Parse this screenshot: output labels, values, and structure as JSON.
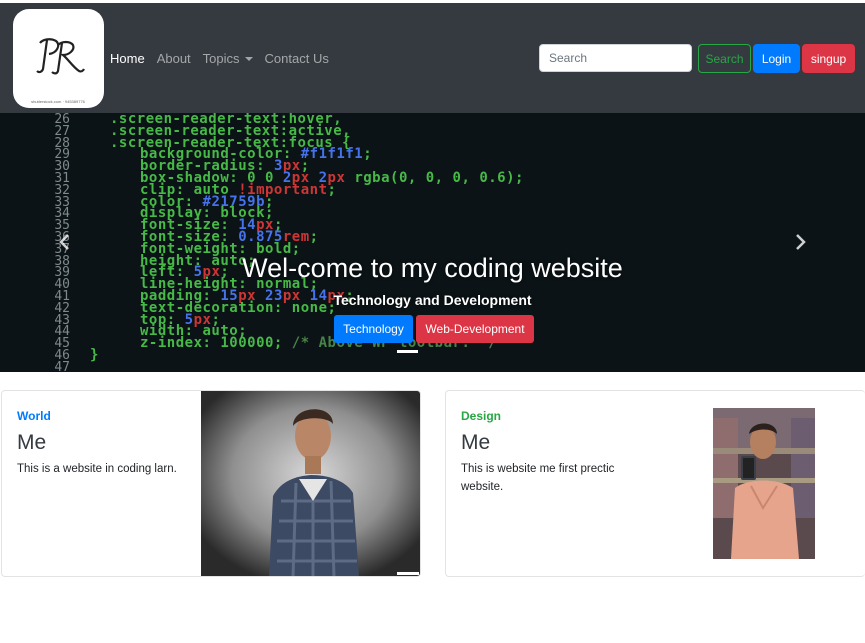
{
  "navbar": {
    "logo_text": "PR",
    "logo_caption": "shutterstock.com · 945389776",
    "links": [
      {
        "label": "Home",
        "active": true
      },
      {
        "label": "About",
        "active": false
      },
      {
        "label": "Topics",
        "active": false,
        "dropdown": true
      },
      {
        "label": "Contact Us",
        "active": false
      }
    ],
    "search_placeholder": "Search",
    "search_button": "Search",
    "login_button": "Login",
    "signup_button": "singup"
  },
  "carousel": {
    "title": "Wel-come to my coding website",
    "subtitle": "Technology and Development",
    "buttons": [
      "Technology",
      "Web-Development"
    ],
    "prev_icon": "chevron-left-icon",
    "next_icon": "chevron-right-icon",
    "code_lines": [
      {
        "n": "26",
        "t": ".screen-reader-text:hover,"
      },
      {
        "n": "27",
        "t": ".screen-reader-text:active,"
      },
      {
        "n": "28",
        "t": ".screen-reader-text:focus {"
      },
      {
        "n": "29",
        "t": "    background-color: #f1f1f1;"
      },
      {
        "n": "30",
        "t": "    border-radius: 3px;"
      },
      {
        "n": "31",
        "t": "    box-shadow: 0 0 2px 2px rgba(0, 0, 0, 0.6);"
      },
      {
        "n": "32",
        "t": "    clip: auto !important;"
      },
      {
        "n": "33",
        "t": "    color: #21759b;"
      },
      {
        "n": "34",
        "t": "    display: block;"
      },
      {
        "n": "35",
        "t": "    font-size: 14px;"
      },
      {
        "n": "36",
        "t": "    font-size: 0.875rem;"
      },
      {
        "n": "37",
        "t": "    font-weight: bold;"
      },
      {
        "n": "38",
        "t": "    height: auto;"
      },
      {
        "n": "39",
        "t": "    left: 5px;"
      },
      {
        "n": "40",
        "t": "    line-height: normal;"
      },
      {
        "n": "41",
        "t": "    padding: 15px 23px 14px;"
      },
      {
        "n": "42",
        "t": "    text-decoration: none;"
      },
      {
        "n": "43",
        "t": "    top: 5px;"
      },
      {
        "n": "44",
        "t": "    width: auto;"
      },
      {
        "n": "45",
        "t": "    z-index: 100000; /* Above WP toolbar. */"
      },
      {
        "n": "46",
        "t": "}"
      },
      {
        "n": "47",
        "t": ""
      }
    ]
  },
  "cards": [
    {
      "category": "World",
      "title": "Me",
      "text": "This is a website in coding larn."
    },
    {
      "category": "Design",
      "title": "Me",
      "text": "This is website me first prectic website."
    }
  ],
  "colors": {
    "navbar": "#343a40",
    "primary": "#007bff",
    "danger": "#dc3545",
    "success": "#28a745"
  }
}
